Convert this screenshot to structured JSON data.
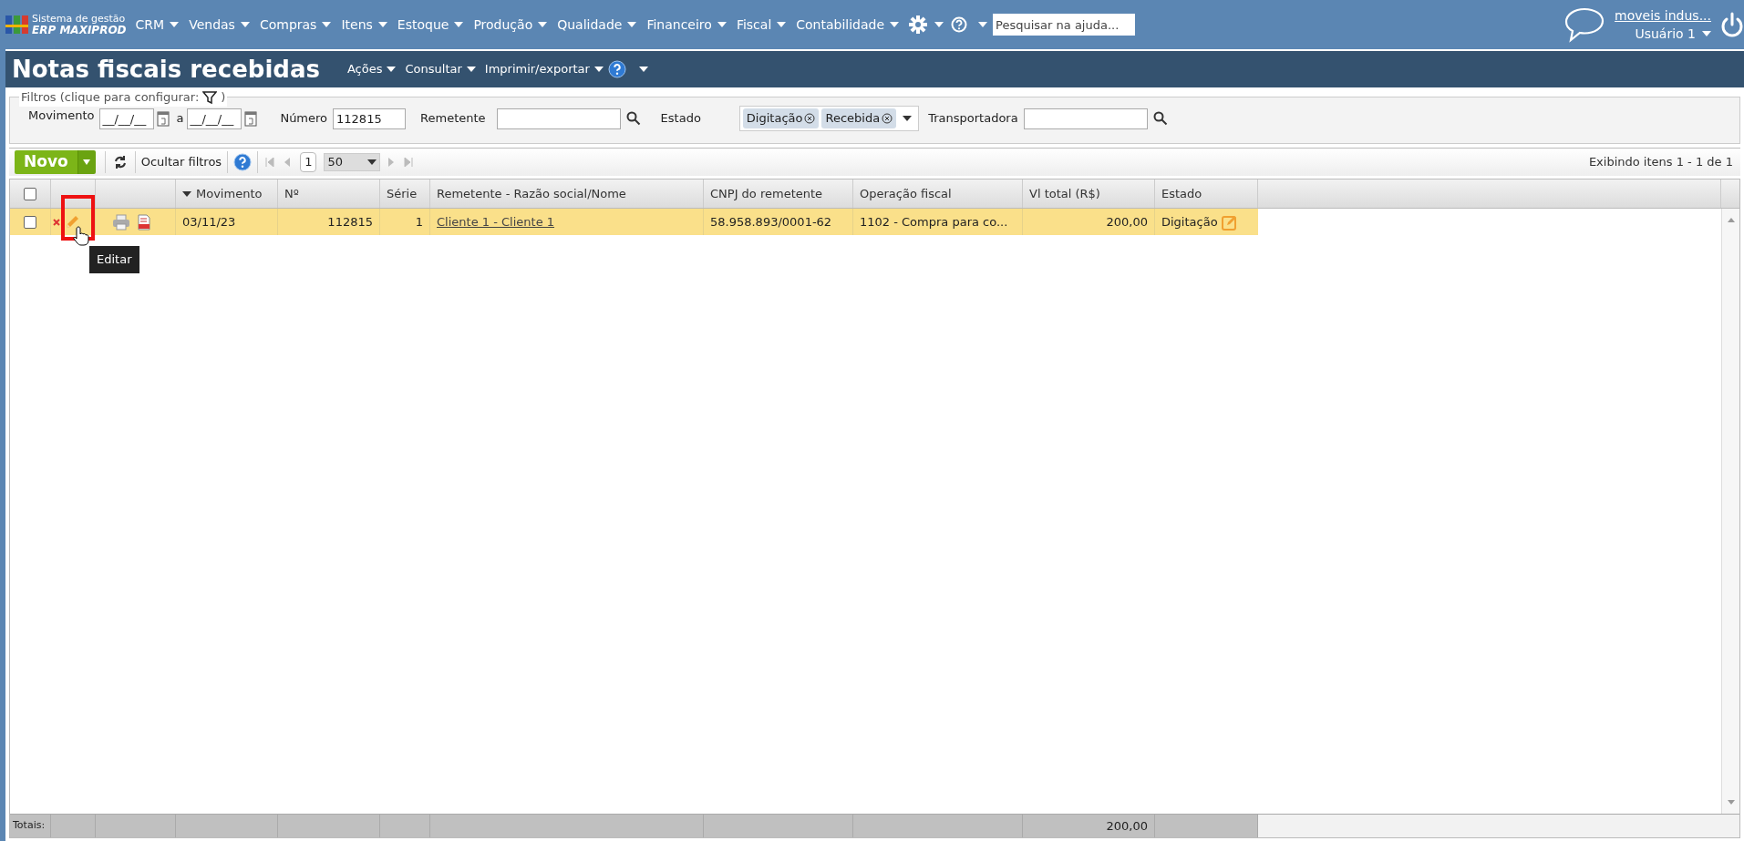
{
  "app": {
    "logo_line1": "Sistema de gestão",
    "logo_line2": "ERP MAXIPROD"
  },
  "menu": [
    "CRM",
    "Vendas",
    "Compras",
    "Itens",
    "Estoque",
    "Produção",
    "Qualidade",
    "Financeiro",
    "Fiscal",
    "Contabilidade"
  ],
  "help_search": {
    "placeholder": "Pesquisar na ajuda..."
  },
  "account": {
    "company": "moveis indus...",
    "user": "Usuário 1"
  },
  "page": {
    "title": "Notas fiscais recebidas",
    "actions": [
      "Ações",
      "Consultar",
      "Imprimir/exportar"
    ]
  },
  "filters": {
    "legend": "Filtros (clique para configurar:",
    "legend_end": ")",
    "movimento": {
      "label": "Movimento",
      "from": "__/__/__",
      "separator": "a",
      "to": "__/__/__"
    },
    "numero": {
      "label": "Número",
      "value": "112815"
    },
    "remetente": {
      "label": "Remetente"
    },
    "estado": {
      "label": "Estado",
      "tags": [
        "Digitação",
        "Recebida"
      ]
    },
    "transportadora": {
      "label": "Transportadora"
    }
  },
  "toolbar": {
    "new_button": "Novo",
    "hide_filters": "Ocultar filtros",
    "page": "1",
    "page_size": "50",
    "summary": "Exibindo itens 1 - 1 de 1"
  },
  "table": {
    "select_all_checked": false,
    "columns": [
      {
        "label": "Movimento",
        "sorted": true
      },
      {
        "label": "Nº",
        "sorted": false
      },
      {
        "label": "Série",
        "sorted": false
      },
      {
        "label": "Remetente - Razão social/Nome",
        "sorted": false
      },
      {
        "label": "CNPJ do remetente",
        "sorted": false
      },
      {
        "label": "Operação fiscal",
        "sorted": false
      },
      {
        "label": "Vl total (R$)",
        "sorted": false
      },
      {
        "label": "Estado",
        "sorted": false
      }
    ],
    "rows": [
      {
        "selected": true,
        "checked": false,
        "movimento": "03/11/23",
        "numero": "112815",
        "serie": "1",
        "remetente": "Cliente 1 - Cliente 1",
        "cnpj": "58.958.893/0001-62",
        "operacao": "1102 - Compra para co...",
        "vl_total": "200,00",
        "estado": "Digitação"
      }
    ],
    "totals": {
      "label": "Totais:",
      "vl_total": "200,00"
    }
  },
  "tooltip": "Editar"
}
